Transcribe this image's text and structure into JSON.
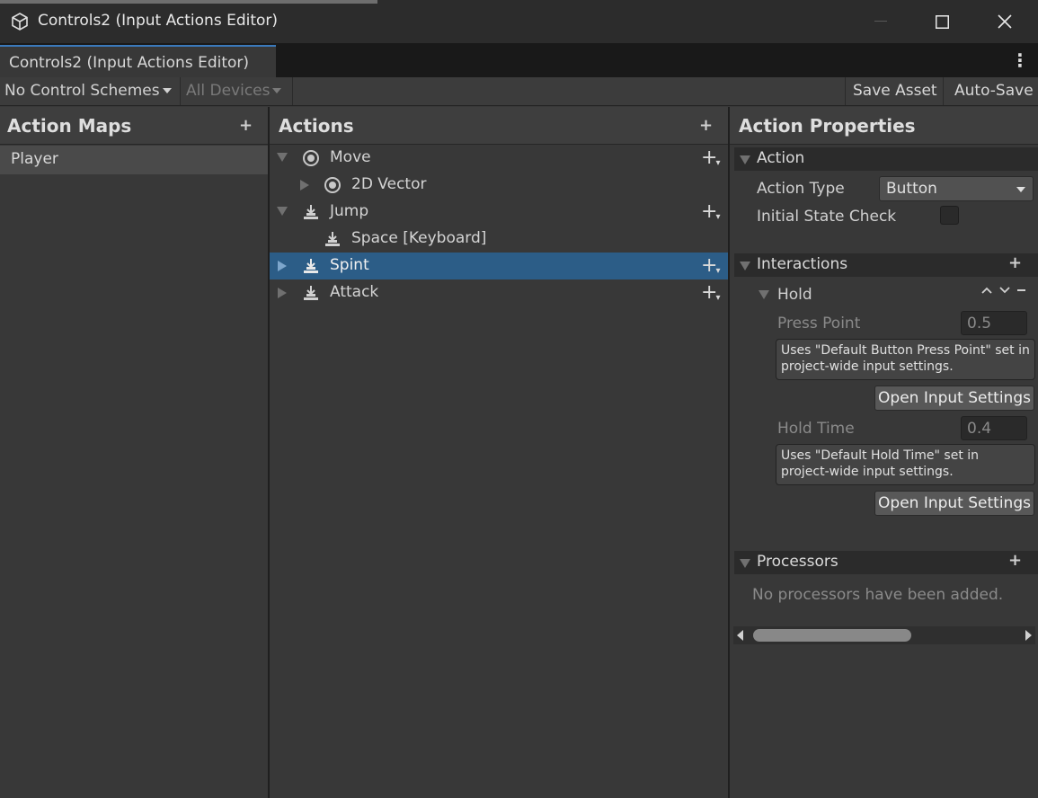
{
  "window": {
    "title": "Controls2 (Input Actions Editor)"
  },
  "tab": {
    "label": "Controls2 (Input Actions Editor)"
  },
  "toolbar": {
    "control_schemes": "No Control Schemes",
    "devices": "All Devices",
    "save_asset": "Save Asset",
    "auto_save": "Auto-Save"
  },
  "action_maps": {
    "title": "Action Maps",
    "add": "+",
    "items": [
      {
        "label": "Player",
        "selected": true
      }
    ]
  },
  "actions": {
    "title": "Actions",
    "add": "+",
    "rows": [
      {
        "label": "Move",
        "icon": "vector-icon",
        "expanded": true
      },
      {
        "label": "2D Vector",
        "icon": "vector-icon",
        "expanded": false
      },
      {
        "label": "Jump",
        "icon": "button-icon",
        "expanded": true
      },
      {
        "label": "Space [Keyboard]",
        "icon": "button-icon"
      },
      {
        "label": "Spint",
        "icon": "button-icon",
        "expanded": false,
        "selected": true
      },
      {
        "label": "Attack",
        "icon": "button-icon",
        "expanded": false
      }
    ]
  },
  "properties": {
    "title": "Action Properties",
    "action_section": "Action",
    "action_type_label": "Action Type",
    "action_type_value": "Button",
    "initial_state_label": "Initial State Check",
    "interactions_section": "Interactions",
    "interactions_add": "+",
    "hold": {
      "title": "Hold",
      "press_point_label": "Press Point",
      "press_point_value": "0.5",
      "press_point_help": "Uses \"Default Button Press Point\" set in project-wide input settings.",
      "open_settings_1": "Open Input Settings",
      "hold_time_label": "Hold Time",
      "hold_time_value": "0.4",
      "hold_time_help": "Uses \"Default Hold Time\" set in project-wide input settings.",
      "open_settings_2": "Open Input Settings"
    },
    "processors_section": "Processors",
    "processors_add": "+",
    "processors_empty": "No processors have been added."
  },
  "colors": {
    "selection": "#2c5d87",
    "tab_accent": "#3a79bb",
    "background": "#383838"
  }
}
